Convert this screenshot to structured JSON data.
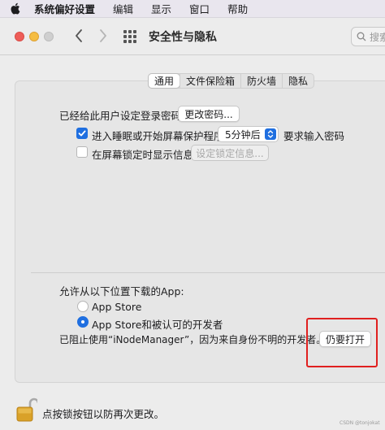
{
  "menubar": {
    "app_name": "系统偏好设置",
    "items": [
      "编辑",
      "显示",
      "窗口",
      "帮助"
    ]
  },
  "window": {
    "title": "安全性与隐私",
    "search_placeholder": "搜索"
  },
  "tabs": [
    "通用",
    "文件保险箱",
    "防火墙",
    "隐私"
  ],
  "active_tab": "通用",
  "general": {
    "password_label": "已经给此用户设定登录密码",
    "change_password_button": "更改密码...",
    "require_password_label": "进入睡眠或开始屏幕保护程序",
    "require_password_checked": true,
    "delay_value": "5分钟后",
    "require_password_suffix": "要求输入密码",
    "lock_message_label": "在屏幕锁定时显示信息",
    "lock_message_checked": false,
    "lock_message_button": "设定锁定信息..."
  },
  "downloads": {
    "heading": "允许从以下位置下载的App:",
    "options": [
      "App Store",
      "App Store和被认可的开发者"
    ],
    "selected_index": 1,
    "blocked_message": "已阻止使用“iNodeManager”，因为来自身份不明的开发者。",
    "open_anyway_button": "仍要打开"
  },
  "footer": {
    "lock_text": "点按锁按钮以防再次更改。",
    "watermark": "CSDN @tonjokat"
  },
  "colors": {
    "accent": "#1f6fe0",
    "highlight": "#e0201f"
  }
}
